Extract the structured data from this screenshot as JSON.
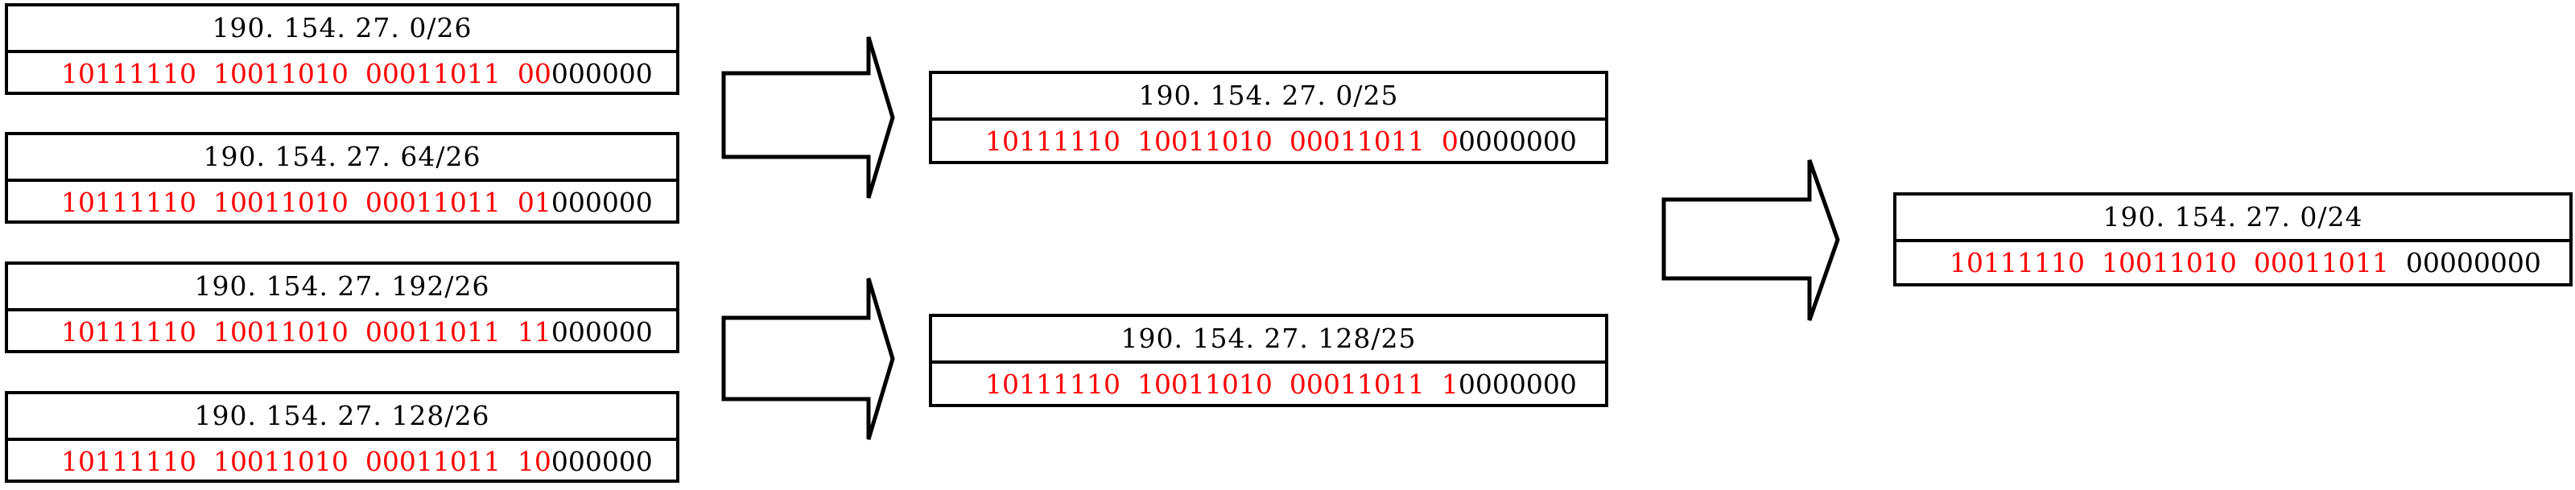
{
  "colors": {
    "network_bits": "#ff0000",
    "host_bits": "#000000",
    "border": "#000000"
  },
  "subnets_26": [
    {
      "cidr": "190. 154. 27. 0/26",
      "binary_network": "10111110  10011010  00011011  00",
      "binary_host": "000000"
    },
    {
      "cidr": "190. 154. 27. 64/26",
      "binary_network": "10111110  10011010  00011011  01",
      "binary_host": "000000"
    },
    {
      "cidr": "190. 154. 27. 192/26",
      "binary_network": "10111110  10011010  00011011  11",
      "binary_host": "000000"
    },
    {
      "cidr": "190. 154. 27. 128/26",
      "binary_network": "10111110  10011010  00011011  10",
      "binary_host": "000000"
    }
  ],
  "subnets_25": [
    {
      "cidr": "190. 154. 27. 0/25",
      "binary_network": "10111110  10011010  00011011  0",
      "binary_host": "0000000"
    },
    {
      "cidr": "190. 154. 27. 128/25",
      "binary_network": "10111110  10011010  00011011  1",
      "binary_host": "0000000"
    }
  ],
  "subnet_24": {
    "cidr": "190. 154. 27. 0/24",
    "binary_network": "10111110  10011010  00011011  ",
    "binary_host": "00000000"
  },
  "arrows": [
    {
      "name": "arrow-26-to-25-upper",
      "direction": "right"
    },
    {
      "name": "arrow-26-to-25-lower",
      "direction": "right"
    },
    {
      "name": "arrow-25-to-24",
      "direction": "right"
    }
  ]
}
